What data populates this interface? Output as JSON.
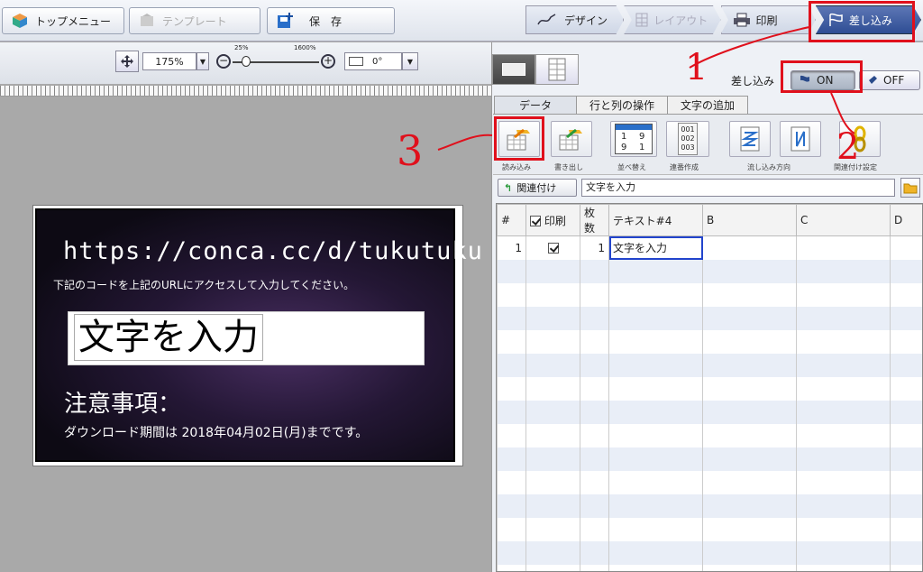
{
  "toolbar": {
    "top_menu": "トップメニュー",
    "template": "テンプレート",
    "save": "保　存"
  },
  "modes": [
    "デザイン",
    "レイアウト",
    "印刷",
    "差し込み"
  ],
  "zoom": {
    "value": "175%",
    "min": "25%",
    "max": "1600%",
    "rotation": "0°"
  },
  "card": {
    "url": "https://conca.cc/d/tukutuku",
    "instruction": "下記のコードを上記のURLにアクセスして入力してください。",
    "input_text": "文字を入力",
    "caution": "注意事項：",
    "download_note": "ダウンロード期間は 2018年04月02日(月)までです。"
  },
  "merge": {
    "label": "差し込み",
    "on": "ON",
    "off": "OFF"
  },
  "tabs": [
    "データ",
    "行と列の操作",
    "文字の追加"
  ],
  "tools": [
    {
      "label": "読み込み"
    },
    {
      "label": "書き出し"
    },
    {
      "label": "並べ替え"
    },
    {
      "label": "連番作成"
    },
    {
      "label": "流し込み方向"
    },
    {
      "label": "関連付け設定"
    }
  ],
  "sort_icon": {
    "a": "1",
    "b": "9",
    "c": "9",
    "d": "1"
  },
  "serial_icon": {
    "l1": "001",
    "l2": "002",
    "l3": "003"
  },
  "link": {
    "button": "関連付け",
    "field_value": "文字を入力"
  },
  "table": {
    "headers": [
      "#",
      "印刷",
      "枚数",
      "テキスト#4",
      "B",
      "C",
      "D"
    ],
    "rows": [
      {
        "no": "1",
        "print": true,
        "count": "1",
        "text": "文字を入力",
        "b": "",
        "c": "",
        "d": ""
      }
    ]
  },
  "annotations": {
    "n1": "1",
    "n2": "2",
    "n3": "3"
  },
  "colors": {
    "annotation": "#e0101c",
    "active_mode": "#2e4d94"
  }
}
